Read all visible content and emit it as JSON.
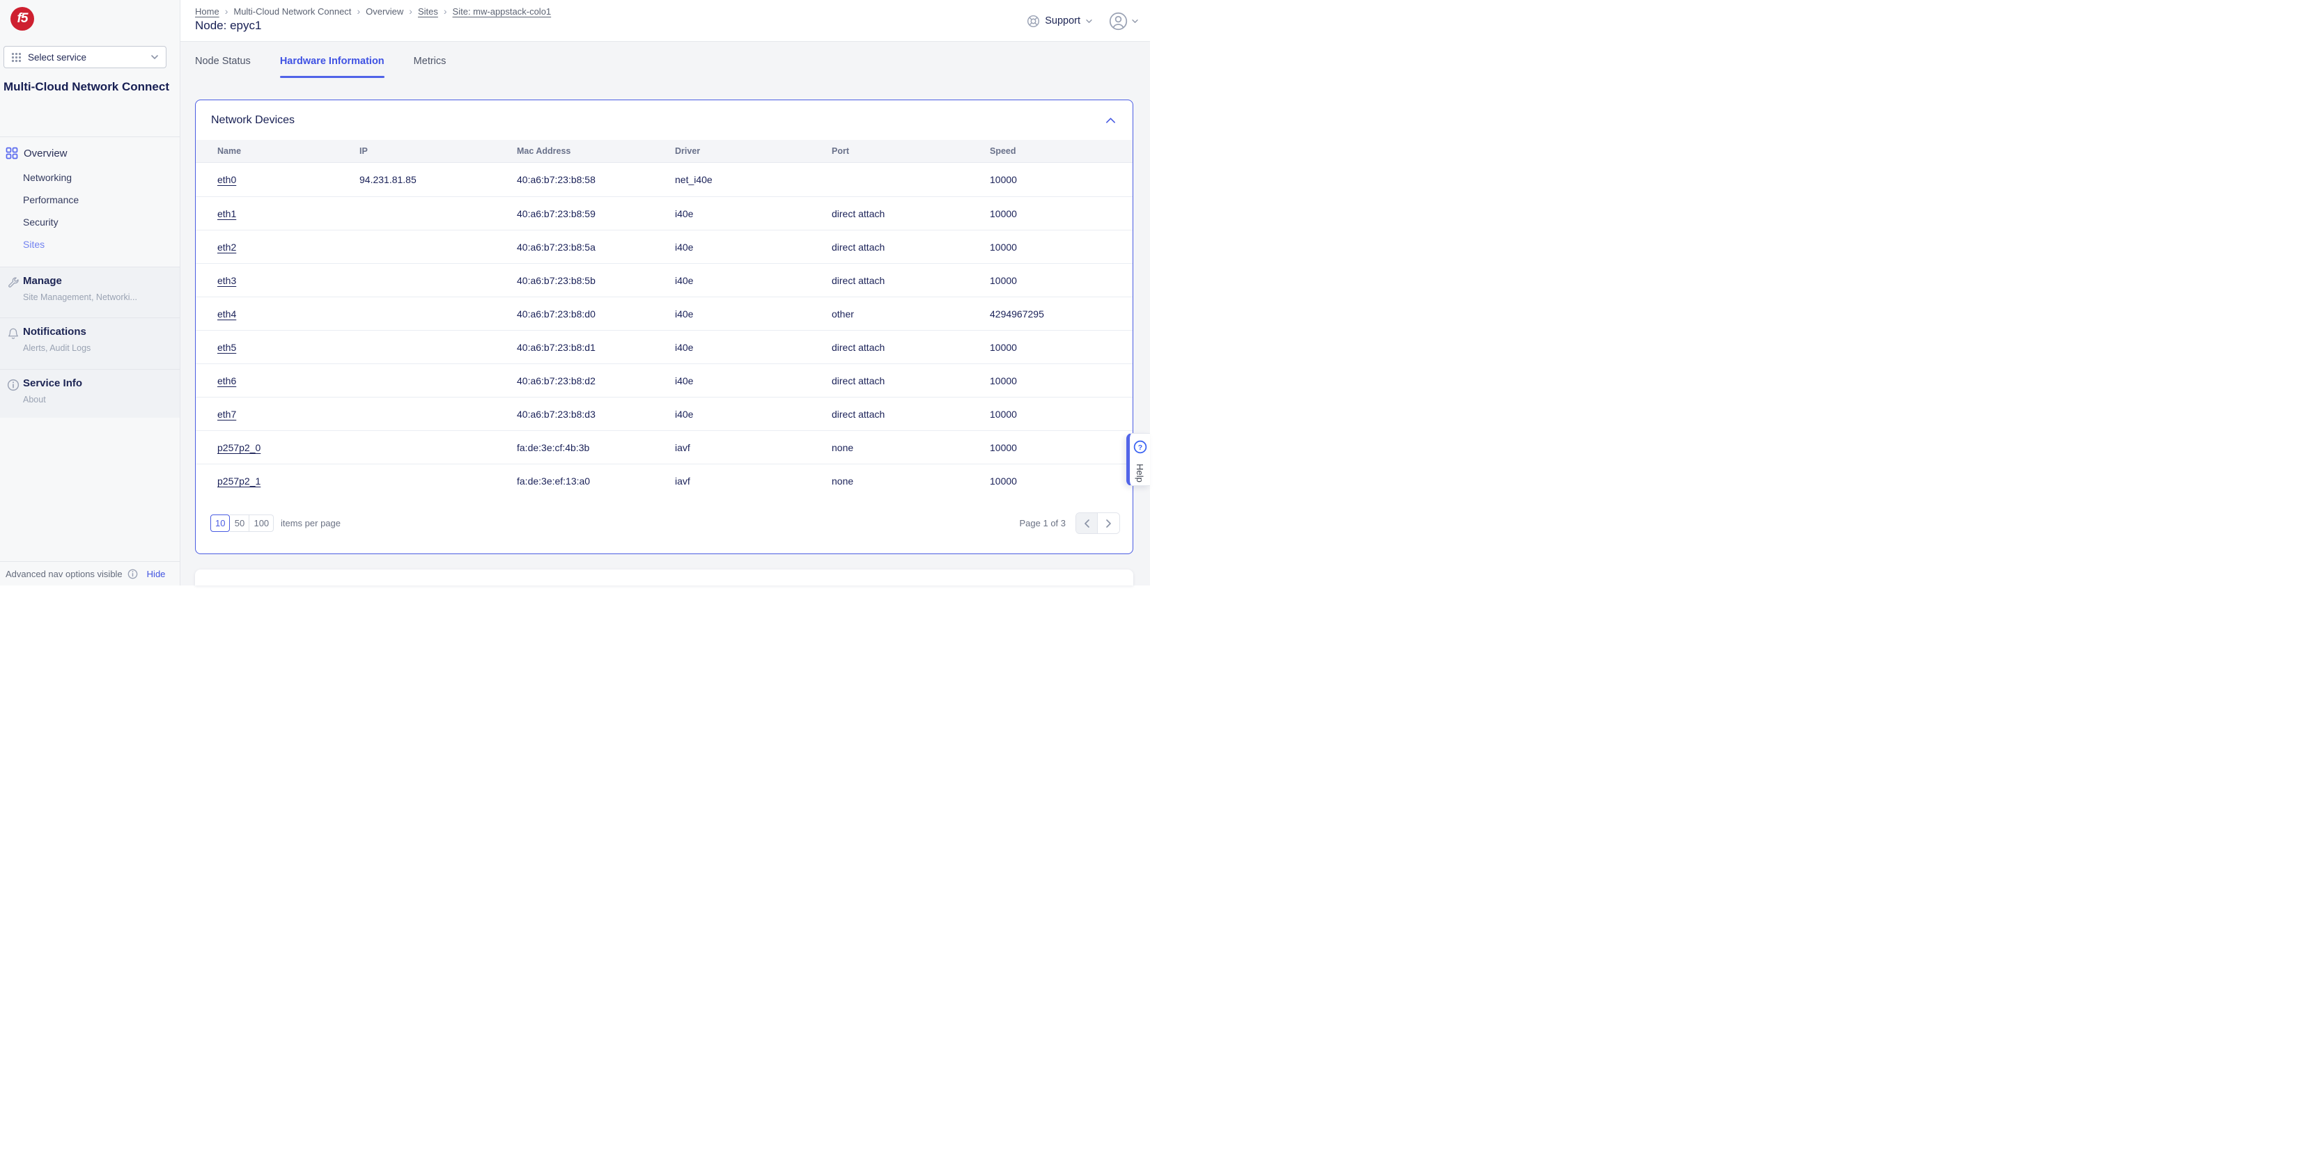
{
  "colors": {
    "accent": "#4a5ce2",
    "accent_light": "#7282f0",
    "navy_text": "#171f53",
    "gray_text": "#6a7183",
    "logo_red": "#ce2030"
  },
  "sidebar": {
    "logo_text": "f5",
    "select_service": {
      "label": "Select service"
    },
    "title": "Multi-Cloud Network Connect",
    "nav": {
      "overview_label": "Overview",
      "children": [
        "Networking",
        "Performance",
        "Security",
        "Sites"
      ],
      "active_child": "Sites"
    },
    "sections": [
      {
        "title": "Manage",
        "subtitle": "Site Management, Networki..."
      },
      {
        "title": "Notifications",
        "subtitle": "Alerts, Audit Logs"
      },
      {
        "title": "Service Info",
        "subtitle": "About"
      }
    ],
    "footer": {
      "note": "Advanced nav options visible",
      "action": "Hide"
    }
  },
  "header": {
    "breadcrumb": [
      {
        "label": "Home",
        "link": true
      },
      {
        "label": "Multi-Cloud Network Connect",
        "link": false
      },
      {
        "label": "Overview",
        "link": false
      },
      {
        "label": "Sites",
        "link": true
      },
      {
        "label": "Site: mw-appstack-colo1",
        "link": true
      }
    ],
    "page_title": "Node: epyc1",
    "support_label": "Support"
  },
  "tabs": [
    {
      "label": "Node Status",
      "active": false
    },
    {
      "label": "Hardware Information",
      "active": true
    },
    {
      "label": "Metrics",
      "active": false
    }
  ],
  "card": {
    "title": "Network Devices",
    "columns": [
      "Name",
      "IP",
      "Mac Address",
      "Driver",
      "Port",
      "Speed"
    ],
    "rows": [
      {
        "name": "eth0",
        "ip": "94.231.81.85",
        "mac": "40:a6:b7:23:b8:58",
        "driver": "net_i40e",
        "port": "",
        "speed": "10000"
      },
      {
        "name": "eth1",
        "ip": "",
        "mac": "40:a6:b7:23:b8:59",
        "driver": "i40e",
        "port": "direct attach",
        "speed": "10000"
      },
      {
        "name": "eth2",
        "ip": "",
        "mac": "40:a6:b7:23:b8:5a",
        "driver": "i40e",
        "port": "direct attach",
        "speed": "10000"
      },
      {
        "name": "eth3",
        "ip": "",
        "mac": "40:a6:b7:23:b8:5b",
        "driver": "i40e",
        "port": "direct attach",
        "speed": "10000"
      },
      {
        "name": "eth4",
        "ip": "",
        "mac": "40:a6:b7:23:b8:d0",
        "driver": "i40e",
        "port": "other",
        "speed": "4294967295"
      },
      {
        "name": "eth5",
        "ip": "",
        "mac": "40:a6:b7:23:b8:d1",
        "driver": "i40e",
        "port": "direct attach",
        "speed": "10000"
      },
      {
        "name": "eth6",
        "ip": "",
        "mac": "40:a6:b7:23:b8:d2",
        "driver": "i40e",
        "port": "direct attach",
        "speed": "10000"
      },
      {
        "name": "eth7",
        "ip": "",
        "mac": "40:a6:b7:23:b8:d3",
        "driver": "i40e",
        "port": "direct attach",
        "speed": "10000"
      },
      {
        "name": "p257p2_0",
        "ip": "",
        "mac": "fa:de:3e:cf:4b:3b",
        "driver": "iavf",
        "port": "none",
        "speed": "10000"
      },
      {
        "name": "p257p2_1",
        "ip": "",
        "mac": "fa:de:3e:ef:13:a0",
        "driver": "iavf",
        "port": "none",
        "speed": "10000"
      }
    ],
    "pagination": {
      "page_sizes": [
        "10",
        "50",
        "100"
      ],
      "selected_size": "10",
      "items_per_page_label": "items per page",
      "page_status": "Page 1 of 3"
    }
  },
  "help": {
    "label": "Help"
  }
}
